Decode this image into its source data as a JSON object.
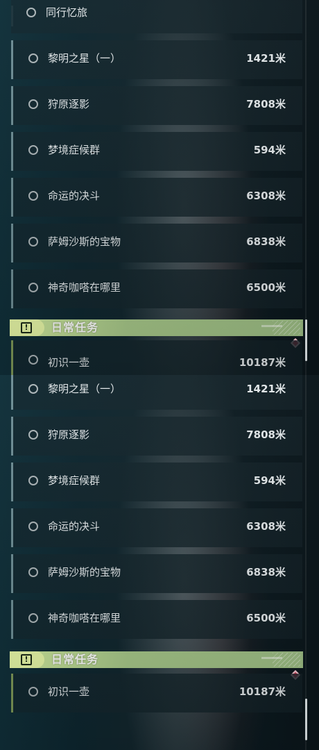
{
  "panel_top": {
    "partial_row": {
      "name": "同行忆旅"
    },
    "quests": [
      {
        "name": "黎明之星（一）",
        "distance": "1421米"
      },
      {
        "name": "狩原逐影",
        "distance": "7808米"
      },
      {
        "name": "梦境症候群",
        "distance": "594米"
      },
      {
        "name": "命运的决斗",
        "distance": "6308米"
      },
      {
        "name": "萨姆沙斯的宝物",
        "distance": "6838米"
      },
      {
        "name": "神奇咖嗒在哪里",
        "distance": "6500米"
      }
    ],
    "section": {
      "title": "日常任务",
      "icon": "exclamation-icon"
    },
    "daily_partial": {
      "name": "初识一壶",
      "distance": "10187米"
    }
  },
  "panel_bottom": {
    "quests": [
      {
        "name": "黎明之星（一）",
        "distance": "1421米"
      },
      {
        "name": "狩原逐影",
        "distance": "7808米"
      },
      {
        "name": "梦境症候群",
        "distance": "594米"
      },
      {
        "name": "命运的决斗",
        "distance": "6308米"
      },
      {
        "name": "萨姆沙斯的宝物",
        "distance": "6838米"
      },
      {
        "name": "神奇咖嗒在哪里",
        "distance": "6500米"
      }
    ],
    "section": {
      "title": "日常任务",
      "icon": "exclamation-icon"
    },
    "daily": [
      {
        "name": "初识一壶",
        "distance": "10187米"
      }
    ]
  },
  "colors": {
    "section_header": "#a7c889",
    "section_pill": "#e9f9a8",
    "marker": "#d7405a",
    "row_accent": "#6f8f96",
    "daily_accent": "#7f9a58"
  }
}
